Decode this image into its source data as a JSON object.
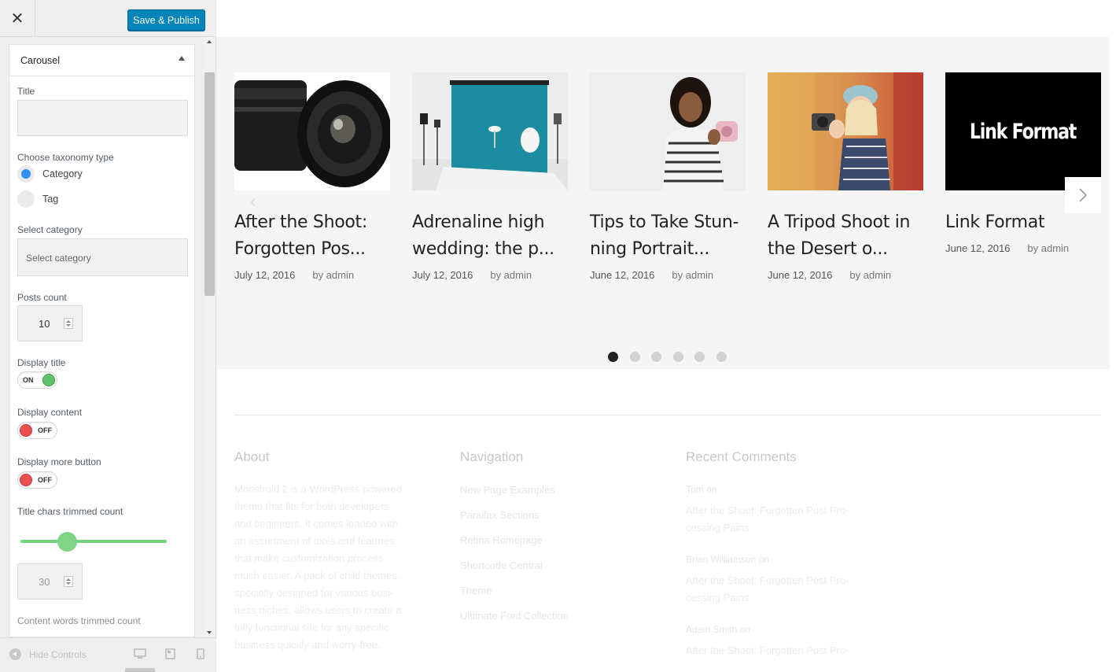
{
  "toolbar": {
    "close_glyph": "✕",
    "publish_label": "Save & Publish"
  },
  "section": {
    "title": "Carousel"
  },
  "fields": {
    "title_label": "Title",
    "taxonomy_label": "Choose taxonomy type",
    "taxonomy_options": [
      "Category",
      "Tag"
    ],
    "taxonomy_selected": "Category",
    "select_category_label": "Select category",
    "select_category_placeholder": "Select category",
    "posts_count_label": "Posts count",
    "posts_count_value": "10",
    "display_title_label": "Display title",
    "display_title_state": "ON",
    "display_content_label": "Display content",
    "display_content_state": "OFF",
    "display_more_label": "Display more button",
    "display_more_state": "OFF",
    "title_chars_label": "Title chars trimmed count",
    "title_chars_value": "30",
    "content_words_label": "Content words trimmed count"
  },
  "footer_controls": {
    "hide_label": "Hide Controls"
  },
  "carousel": {
    "posts": [
      {
        "title_line1": "After the Shoot:",
        "title_line2": "Forgotten Pos...",
        "date": "July 12, 2016",
        "author": "by admin",
        "image": "camera-lenses"
      },
      {
        "title_line1": "Adrenaline high",
        "title_line2": "wedding: the p...",
        "date": "July 12, 2016",
        "author": "by admin",
        "image": "photo-studio"
      },
      {
        "title_line1": "Tips to Take Stun-",
        "title_line2": "ning Portrait...",
        "date": "June 12, 2016",
        "author": "by admin",
        "image": "woman-camera"
      },
      {
        "title_line1": "A Tripod Shoot in",
        "title_line2": "the Desert o...",
        "date": "June 12, 2016",
        "author": "by admin",
        "image": "girl-camera"
      },
      {
        "title_line1": "Link Format",
        "title_line2": "",
        "date": "June 12, 2016",
        "author": "by admin",
        "image": "link-format"
      }
    ],
    "link_image_text": "Link Format",
    "dots": 6,
    "active_dot": 0
  },
  "site_footer": {
    "about": {
      "heading": "About",
      "lines": [
        "Monstroid 2 is a WordPress powered",
        "theme that fits for both developers",
        "and beginners. It comes loaded with",
        "an assortment of tools and features",
        "that make customization process",
        "much easier. A pack of child themes,",
        "specially designed for various busi-",
        "ness niches, allows users to create a",
        "fully functional site for any specific",
        "business quickly and worry-free."
      ]
    },
    "navigation": {
      "heading": "Navigation",
      "links": [
        "New Page Examples",
        "Parallax Sections",
        "Retina Homepage",
        "Shortcode Central",
        "Theme",
        "Ultimate Font Collection"
      ]
    },
    "comments": {
      "heading": "Recent Comments",
      "items": [
        {
          "author": "Tom on",
          "line1": "After the Shoot: Forgotten Post Pro-",
          "line2": "cessing Pains"
        },
        {
          "author": "Brian Williamson on",
          "line1": "After the Shoot: Forgotten Post Pro-",
          "line2": "cessing Pains"
        },
        {
          "author": "Adam Smith on",
          "line1": "After the Shoot: Forgotten Post Pro-",
          "line2": ""
        }
      ]
    }
  },
  "colors": {
    "accent": "#0085ba",
    "toggle_on": "#5fc16b",
    "toggle_off": "#ed4f4f",
    "radio": "#2f8ff5",
    "slider": "#76d37f"
  }
}
